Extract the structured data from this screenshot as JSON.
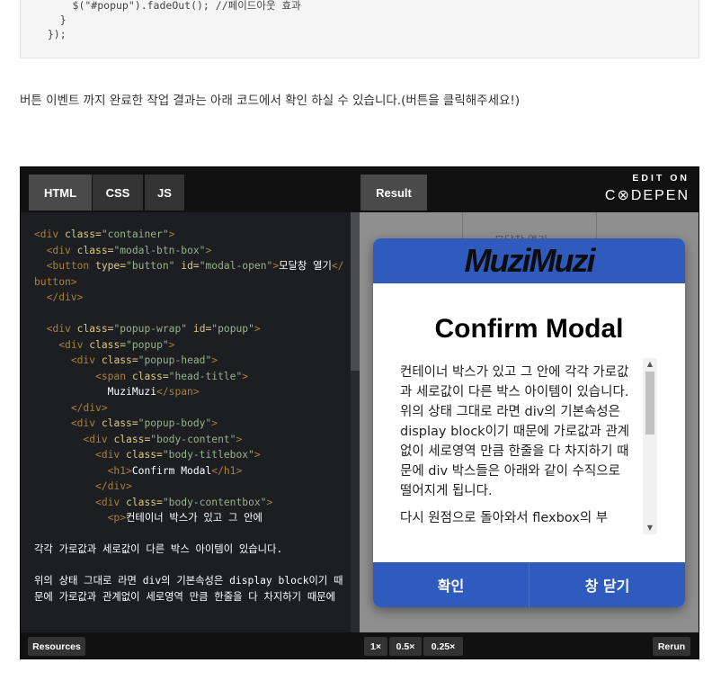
{
  "snippet": {
    "lines": [
      "      $(\"#popup\").fadeOut(); //페이드아웃 효과",
      "    }",
      "  });"
    ]
  },
  "article": {
    "paragraph": "버튼 이벤트 까지 완료한 작업 결과는 아래 코드에서 확인 하실 수 있습니다.(버튼을 클릭해주세요!)"
  },
  "codepen": {
    "tabs": {
      "html": "HTML",
      "css": "CSS",
      "js": "JS",
      "result": "Result"
    },
    "logo": {
      "edit": "EDIT ON",
      "brand": "C⊗DEPEN"
    },
    "bottom": {
      "resources": "Resources",
      "zoom_1": "1×",
      "zoom_05": "0.5×",
      "zoom_025": "0.25×",
      "rerun": "Rerun"
    }
  },
  "result": {
    "background_button": "모달창 열기",
    "modal": {
      "head": "MuziMuzi",
      "title": "Confirm Modal",
      "paragraph1": "컨테이너 박스가 있고 그 안에 각각 가로값과 세로값이 다른 박스 아이템이 있습니다. 위의 상태 그대로 라면 div의 기본속성은 display block이기 때문에 가로값과 관계없이 세로영역 만큼 한줄을 다 차지하기 때문에 div 박스들은 아래와 같이 수직으로 떨어지게 됩니다.",
      "paragraph2": "다시 원점으로 돌아와서 flexbox의 부",
      "confirm": "확인",
      "close": "창 닫기"
    }
  },
  "colors": {
    "modal_blue": "#2f5bbf",
    "editor_bg": "#1d1e22"
  }
}
